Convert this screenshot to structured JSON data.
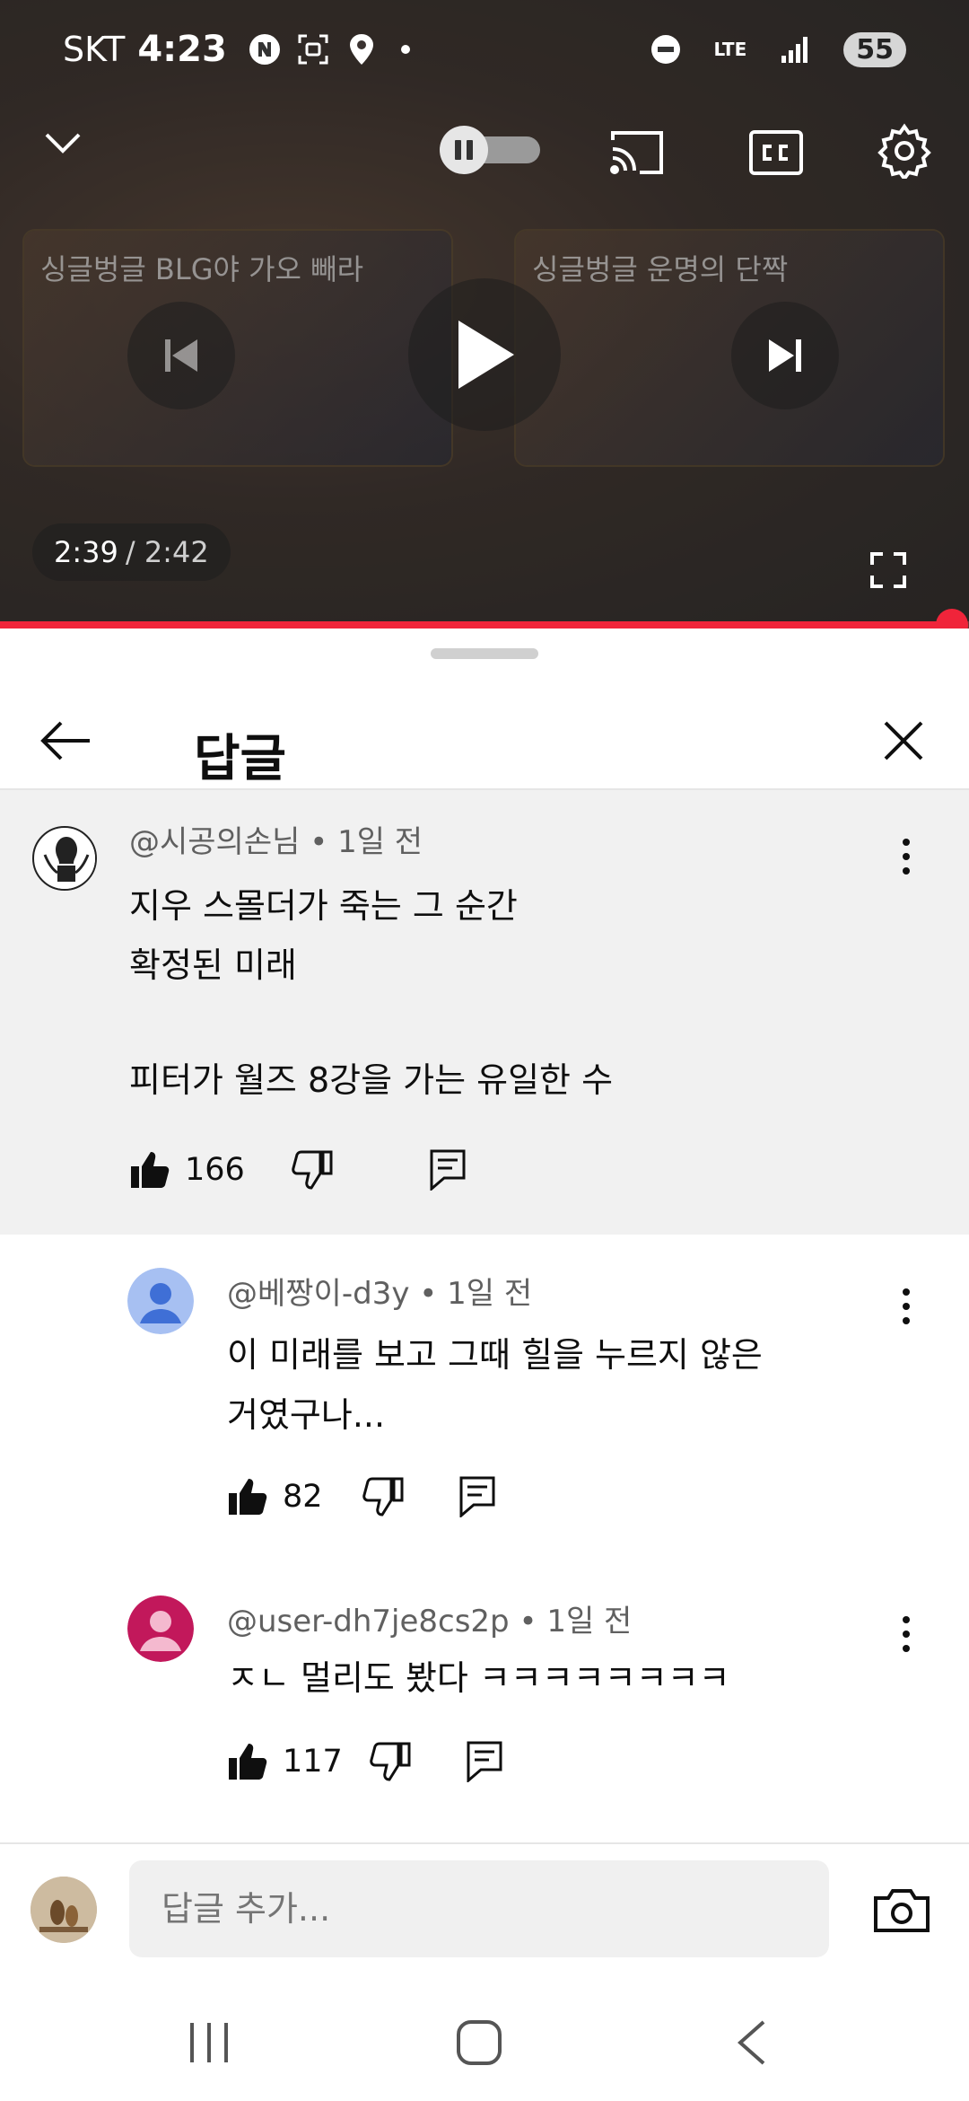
{
  "status_bar": {
    "carrier": "SKT",
    "time": "4:23",
    "network": "LTE",
    "battery": "55"
  },
  "player": {
    "current_time": "2:39",
    "duration": "/ 2:42",
    "progress": 0.982,
    "autoplay_state": "paused",
    "cards": [
      {
        "title": "싱글벙글 BLG야 가오 빼라"
      },
      {
        "title": "싱글벙글 운명의 단짝"
      }
    ]
  },
  "sheet": {
    "title": "답글"
  },
  "parent_comment": {
    "author": "@시공의손님",
    "age": "• 1일 전",
    "lines": [
      "지우 스몰더가 죽는 그 순간",
      "확정된 미래",
      "",
      "피터가 월즈 8강을 가는 유일한 수"
    ],
    "likes": "166"
  },
  "replies": [
    {
      "author": "@베짱이-d3y",
      "age": "• 1일 전",
      "lines": [
        "이 미래를 보고 그때 힐을 누르지 않은",
        "거였구나..."
      ],
      "likes": "82",
      "avatar_color": "#a7c0f2",
      "avatar_fg": "#3f6fd6"
    },
    {
      "author": "@user-dh7je8cs2p",
      "age": "• 1일 전",
      "lines": [
        "ㅈㄴ 멀리도 봤다 ㅋㅋㅋㅋㅋㅋㅋㅋ"
      ],
      "likes": "117",
      "avatar_color": "#c2185b",
      "avatar_fg": "#f4b9cf"
    }
  ],
  "input": {
    "placeholder": "답글 추가..."
  },
  "colors": {
    "accent_red": "#f0243a",
    "sheet_bg": "#ffffff",
    "parent_bg": "#f1f1f1"
  }
}
